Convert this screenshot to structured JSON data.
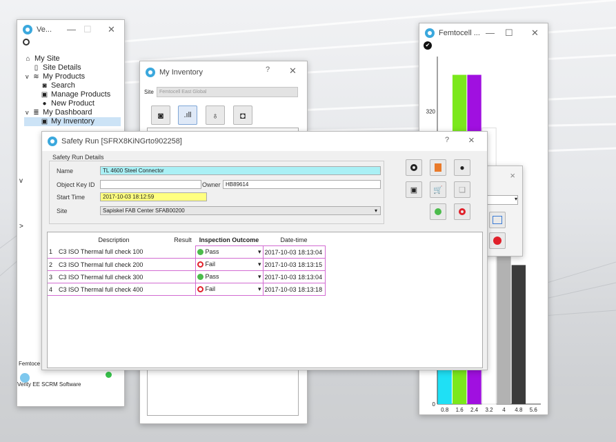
{
  "left_window": {
    "title": "Ve...",
    "tree": [
      {
        "label": "My Site",
        "icon": "home-icon",
        "indent": 0,
        "twisty": ""
      },
      {
        "label": "Site Details",
        "icon": "document-icon",
        "indent": 1,
        "twisty": ""
      },
      {
        "label": "My Products",
        "icon": "layers-icon",
        "indent": 1,
        "twisty": "v"
      },
      {
        "label": "Search",
        "icon": "search-icon",
        "indent": 2,
        "twisty": ""
      },
      {
        "label": "Manage Products",
        "icon": "package-icon",
        "indent": 2,
        "twisty": ""
      },
      {
        "label": "New Product",
        "icon": "plus-icon",
        "indent": 2,
        "twisty": ""
      },
      {
        "label": "My Dashboard",
        "icon": "database-icon",
        "indent": 1,
        "twisty": "v"
      },
      {
        "label": "My Inventory",
        "icon": "package-icon",
        "indent": 2,
        "twisty": ""
      }
    ],
    "footer_label": "Femtoce",
    "brand_label": "Verity EE SCRM Software"
  },
  "inventory_window": {
    "title": "My Inventory",
    "site_label": "Site",
    "site_value": "Femtocell East Global"
  },
  "chart_window": {
    "title": "Femtocell ..."
  },
  "chart_data": {
    "type": "bar",
    "title": "",
    "xlabel": "",
    "ylabel": "",
    "x_ticks": [
      "0.8",
      "1.6",
      "2.4",
      "3.2",
      "4",
      "4.8",
      "5.6"
    ],
    "y_ticks": [
      "0",
      "320"
    ],
    "ylim": [
      0,
      380
    ],
    "bars": [
      {
        "x": 0.8,
        "value": 42,
        "color": "#1fe0f5"
      },
      {
        "x": 1.6,
        "value": 360,
        "color": "#7be81c"
      },
      {
        "x": 2.4,
        "value": 360,
        "color": "#a010e0"
      },
      {
        "x": 3.2,
        "value": 302,
        "color": "#ffffff"
      },
      {
        "x": 4.0,
        "value": 255,
        "color": "#b2b2b2"
      },
      {
        "x": 4.8,
        "value": 152,
        "color": "#3b3b3b"
      }
    ]
  },
  "small_window": {
    "close": "×"
  },
  "dialog": {
    "title": "Safety Run [SFRX8KiNGrto902258]",
    "help": "?",
    "close": "×",
    "group_label": "Safety Run Details",
    "name_label": "Name",
    "name_value": "TL 4600 Steel Connector",
    "object_key_label": "Object Key ID",
    "object_key_value": "",
    "owner_label": "Owner",
    "owner_value": "HB89614",
    "start_time_label": "Start Time",
    "start_time_value": "2017-10-03 18:12:59",
    "site_label": "Site",
    "site_value": "Sapiskel FAB Center SFAB00200",
    "table": {
      "headers": [
        "Description",
        "Result",
        "Inspection Outcome",
        "Date-time"
      ],
      "rows": [
        {
          "n": "1",
          "description": "C3 ISO Thermal full check 100",
          "result": "",
          "outcome": "Pass",
          "datetime": "2017-10-03 18:13:04"
        },
        {
          "n": "2",
          "description": "C3 ISO Thermal full check 200",
          "result": "",
          "outcome": "Fail",
          "datetime": "2017-10-03 18:13:15"
        },
        {
          "n": "3",
          "description": "C3 ISO Thermal full check 300",
          "result": "",
          "outcome": "Pass",
          "datetime": "2017-10-03 18:13:04"
        },
        {
          "n": "4",
          "description": "C3 ISO Thermal full check 400",
          "result": "",
          "outcome": "Fail",
          "datetime": "2017-10-03 18:13:18"
        }
      ]
    },
    "colors": {
      "name_bg": "#aaf0f5",
      "time_bg": "#ffff80",
      "pass": "#4cbb4c",
      "fail": "#e0202a",
      "row_border": "#d26ad2"
    }
  }
}
